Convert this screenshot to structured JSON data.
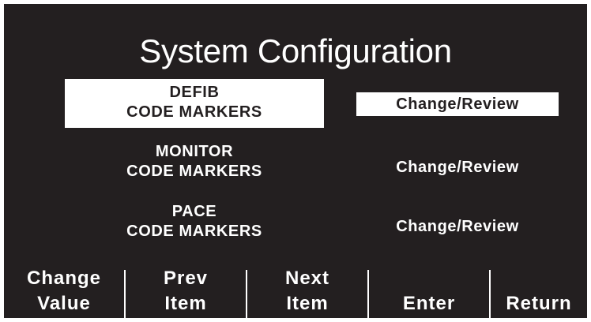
{
  "screen": {
    "title": "System Configuration"
  },
  "menu": {
    "items": [
      {
        "label_line1": "DEFIB",
        "label_line2": "CODE MARKERS",
        "action": "Change/Review",
        "selected": true
      },
      {
        "label_line1": "MONITOR",
        "label_line2": "CODE MARKERS",
        "action": "Change/Review",
        "selected": false
      },
      {
        "label_line1": "PACE",
        "label_line2": "CODE MARKERS",
        "action": "Change/Review",
        "selected": false
      }
    ]
  },
  "softkeys": [
    {
      "line1": "Change",
      "line2": "Value"
    },
    {
      "line1": "Prev",
      "line2": "Item"
    },
    {
      "line1": "Next",
      "line2": "Item"
    },
    {
      "line1": "",
      "line2": "Enter"
    },
    {
      "line1": "",
      "line2": "Return"
    }
  ],
  "colors": {
    "background": "#231f20",
    "foreground": "#ffffff",
    "highlight": "#ffffff",
    "highlight_text": "#231f20"
  }
}
